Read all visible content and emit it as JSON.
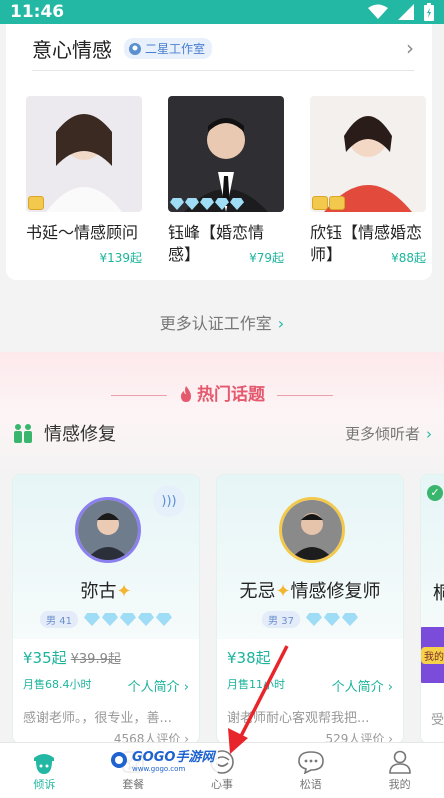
{
  "status_bar": {
    "time": "11:46"
  },
  "studio": {
    "title": "意心情感",
    "badge": "二星工作室",
    "counselors": [
      {
        "name": "书延～情感顾问",
        "price": "¥139起",
        "photo_bg": "#ece9ef",
        "badge_type": "crown"
      },
      {
        "name": "钰峰【婚恋情感】",
        "price": "¥79起",
        "photo_bg": "#2f2f33",
        "badge_type": "gems"
      },
      {
        "name": "欣钰【情感婚恋师】",
        "price": "¥88起",
        "photo_bg": "#e24a3b",
        "badge_type": "crown"
      }
    ],
    "more_label": "更多认证工作室"
  },
  "hot_topics": {
    "title": "热门话题",
    "section_title": "情感修复",
    "more_label": "更多倾听者",
    "listeners": [
      {
        "name": "弥古",
        "tag": "男 41",
        "price": "¥35起",
        "old_price": "¥39.9起",
        "monthly": "月售68.4小时",
        "intro": "个人简介",
        "review": "感谢老师。，很专业，善...",
        "review_count": "4568人评价"
      },
      {
        "name": "无忌",
        "title_suffix": "情感修复师",
        "tag": "男 37",
        "price": "¥38起",
        "monthly": "月售11",
        "monthly_suffix": "小时",
        "intro": "个人简介",
        "review": "谢",
        "review_suffix": "老师耐心客观帮我把...",
        "review_count": "529人评价"
      }
    ],
    "side_label_1": "桐",
    "side_label_2": "受",
    "side_badge": "我的"
  },
  "bottom_nav": [
    {
      "label": "倾诉",
      "icon": "acorn-icon",
      "active": true
    },
    {
      "label": "套餐",
      "icon": "package-icon",
      "active": false
    },
    {
      "label": "心事",
      "icon": "face-icon",
      "active": false
    },
    {
      "label": "松语",
      "icon": "chat-icon",
      "active": false
    },
    {
      "label": "我的",
      "icon": "user-icon",
      "active": false
    }
  ],
  "watermark": {
    "text": "GOGO手游网",
    "sub": "www.gogo.com"
  },
  "colors": {
    "accent": "#23b8a4",
    "hot": "#e4596e",
    "arrow": "#e8252b"
  }
}
